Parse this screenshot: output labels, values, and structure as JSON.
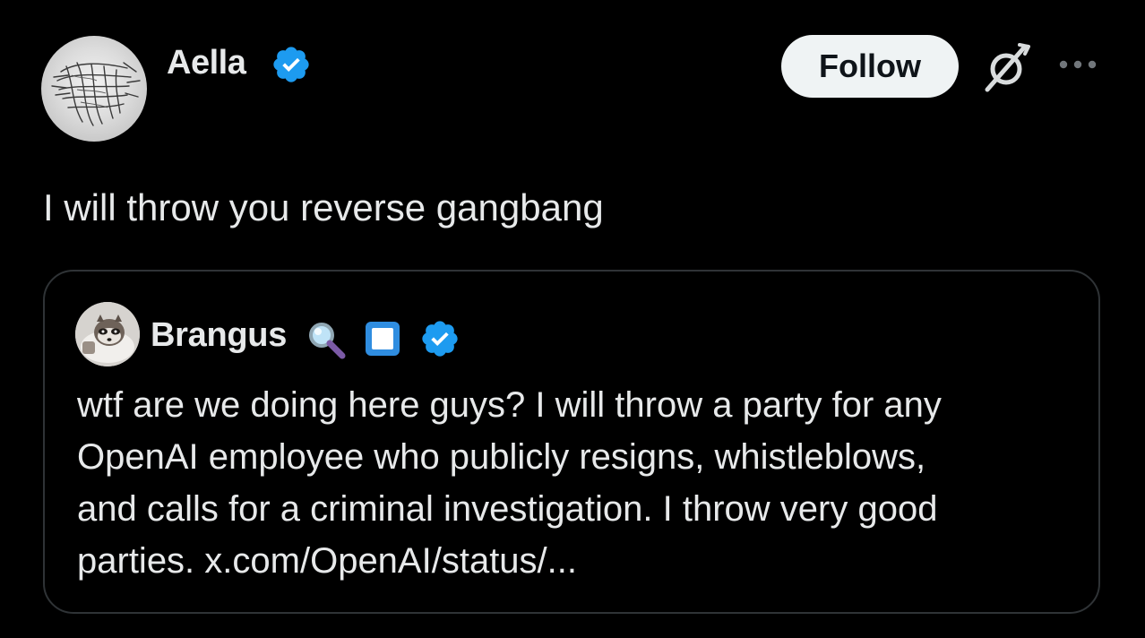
{
  "tweet": {
    "author_name": "Aella",
    "follow_label": "Follow",
    "text": "I will throw you reverse gangbang"
  },
  "quote": {
    "author_name": "Brangus",
    "text_lines": [
      "wtf are we doing here guys? I will throw a party for any",
      "OpenAI employee who publicly resigns, whistleblows,",
      "and calls for a criminal investigation. I throw very good",
      "parties. x.com/OpenAI/status/..."
    ]
  },
  "icons": {
    "verified": "verified-badge-icon",
    "grok": "grok-icon",
    "more": "more-options-icon",
    "magnifier": "magnifying-glass-emoji",
    "square": "blue-square-button-emoji"
  },
  "colors": {
    "background": "#000000",
    "text": "#e7e9ea",
    "verified_blue": "#1d9bf0",
    "border": "#2f3336",
    "follow_bg": "#eff3f4"
  }
}
